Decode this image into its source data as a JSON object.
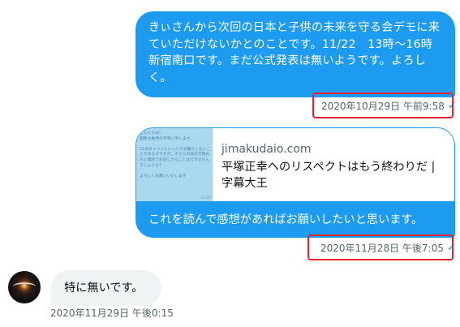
{
  "conversation": {
    "messages": [
      {
        "direction": "outgoing",
        "text": "きぃさんから次回の日本と子供の未来を守る会デモに来ていただけないかとのことです。11/22　13時〜16時　新宿南口です。まだ公式発表は無いようです。よろしく。",
        "timestamp": "2020年10月29日 午前9:58",
        "read_icon": "check-icon",
        "highlighted": true
      },
      {
        "direction": "outgoing",
        "link_card": {
          "domain": "jimakudaio.com",
          "title": "平塚正幸へのリスペクトはもう終わりだ | 字幕大王",
          "thumbnail_text": "こんにちは!\n国民主権党の平塚と申します。\n\n21日のイベントについてお聞きしたいことがあるのですが、そちらの会の代表の方と電話でお話しすることはできませんでしょうか?\n\nよろしくお願いいたします",
          "thumbnail_time": "17:28"
        },
        "text": "これを読んで感想があればお願いしたいと思います。",
        "timestamp": "2020年11月28日 午後7:05",
        "read_icon": "check-icon",
        "highlighted": true
      },
      {
        "direction": "incoming",
        "avatar_icon": "avatar-eclipse-icon",
        "text": "特に無いです。",
        "timestamp": "2020年11月29日 午後0:15"
      }
    ]
  },
  "icons": {
    "check_glyph": "✓"
  },
  "colors": {
    "accent": "#1d9bf0",
    "incoming_bubble": "#eff3f4",
    "highlight": "#e8232e",
    "timestamp": "#536471"
  }
}
